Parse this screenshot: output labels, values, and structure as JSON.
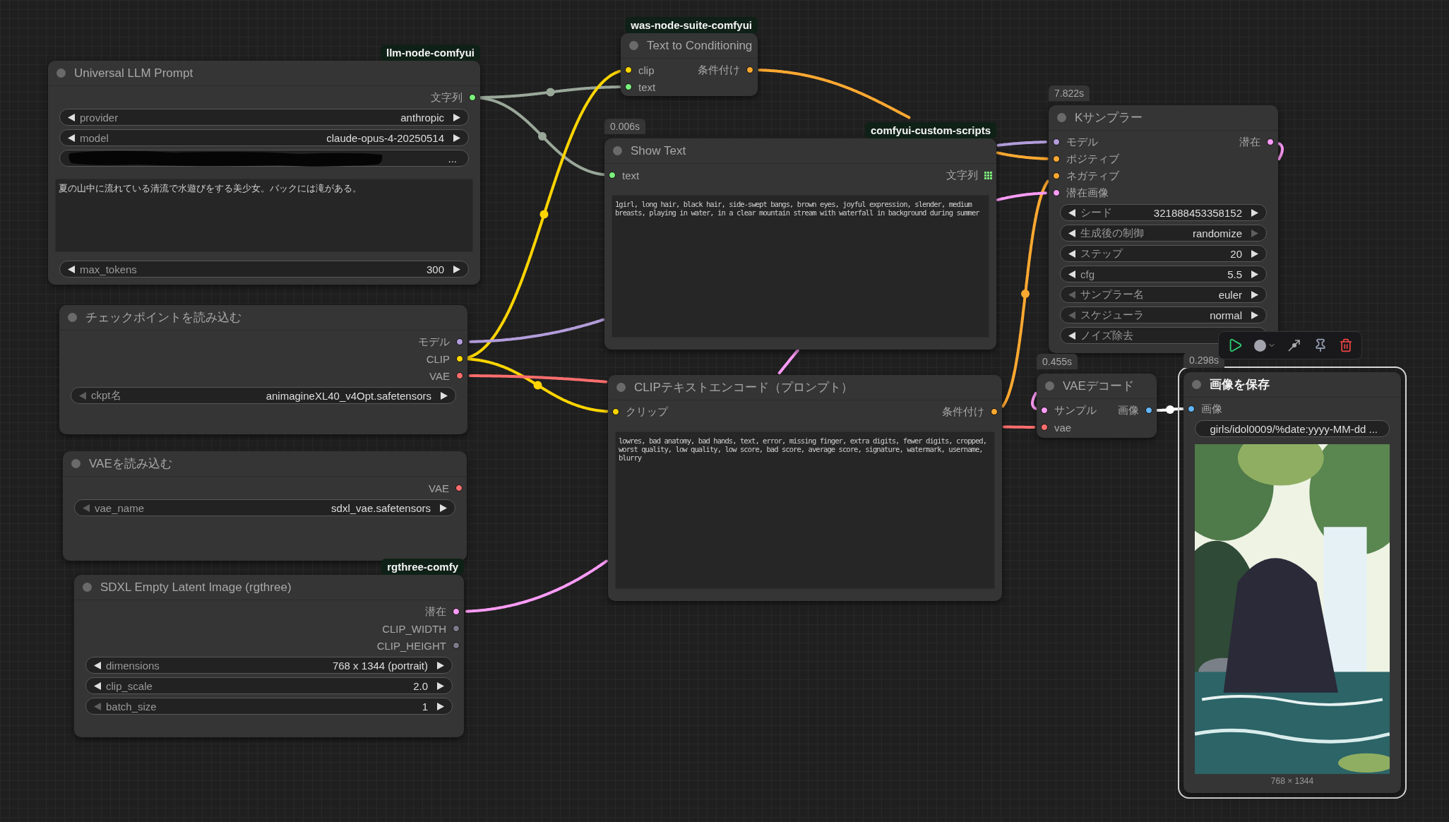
{
  "nodes": [
    {
      "title": "Universal LLM Prompt",
      "badge": "llm-node-comfyui",
      "selected": false,
      "slots": [
        {
          "output": {
            "label": "文字列",
            "color": "#7cf07c"
          }
        }
      ],
      "widgets": [
        {
          "kind": "stepper",
          "label": "provider",
          "value": "anthropic",
          "prev_enabled": true,
          "next_enabled": true
        },
        {
          "kind": "stepper",
          "label": "model",
          "value": "claude-opus-4-20250514",
          "prev_enabled": true,
          "next_enabled": true
        },
        {
          "kind": "text",
          "value": "...",
          "redacted": true
        },
        {
          "kind": "textarea",
          "value": "夏の山中に流れている清流で水遊びをする美少女。バックには滝がある。"
        },
        {
          "kind": "stepper",
          "label": "max_tokens",
          "value": "300",
          "prev_enabled": true,
          "next_enabled": true
        }
      ]
    },
    {
      "title": "Text to Conditioning",
      "badge": "was-node-suite-comfyui",
      "selected": false,
      "slots": [
        {
          "input": {
            "label": "clip",
            "color": "#ffd500"
          },
          "output": {
            "label": "条件付け",
            "color": "#ffa931"
          }
        },
        {
          "input": {
            "label": "text",
            "color": "#7cf07c"
          }
        }
      ]
    },
    {
      "title": "Show Text",
      "badge": "comfyui-custom-scripts",
      "timing": "0.006s",
      "selected": false,
      "slots": [
        {
          "input": {
            "label": "text",
            "color": "#7cf07c"
          },
          "output": {
            "label": "文字列",
            "color": "#7cf07c",
            "is_list": true
          }
        }
      ],
      "widgets": [
        {
          "kind": "code_textarea",
          "value": "1girl, long hair, black hair, side-swept bangs, brown eyes, joyful expression, slender, medium breasts, playing in water, in a clear mountain stream with waterfall in background during summer"
        }
      ]
    },
    {
      "title": "Kサンプラー",
      "timing": "7.822s",
      "selected": false,
      "slots": [
        {
          "input": {
            "label": "モデル",
            "color": "#b39ddb"
          },
          "output": {
            "label": "潜在",
            "color": "#ff9cf9"
          }
        },
        {
          "input": {
            "label": "ポジティブ",
            "color": "#ffa931"
          }
        },
        {
          "input": {
            "label": "ネガティブ",
            "color": "#ffa931"
          }
        },
        {
          "input": {
            "label": "潜在画像",
            "color": "#ff9cf9"
          }
        }
      ],
      "widgets": [
        {
          "kind": "stepper",
          "label": "シード",
          "value": "321888453358152",
          "prev_enabled": true,
          "next_enabled": true
        },
        {
          "kind": "stepper",
          "label": "生成後の制御",
          "value": "randomize",
          "prev_enabled": true,
          "next_enabled": false
        },
        {
          "kind": "stepper",
          "label": "ステップ",
          "value": "20",
          "prev_enabled": true,
          "next_enabled": true
        },
        {
          "kind": "stepper",
          "label": "cfg",
          "value": "5.5",
          "prev_enabled": true,
          "next_enabled": true
        },
        {
          "kind": "stepper",
          "label": "サンプラー名",
          "value": "euler",
          "prev_enabled": false,
          "next_enabled": true
        },
        {
          "kind": "stepper",
          "label": "スケジューラ",
          "value": "normal",
          "prev_enabled": false,
          "next_enabled": true
        },
        {
          "kind": "stepper",
          "label": "ノイズ除去",
          "prev_enabled": true
        }
      ]
    },
    {
      "title": "チェックポイントを読み込む",
      "selected": false,
      "slots": [
        {
          "output": {
            "label": "モデル",
            "color": "#b39ddb"
          }
        },
        {
          "output": {
            "label": "CLIP",
            "color": "#ffd500"
          }
        },
        {
          "output": {
            "label": "VAE",
            "color": "#ff6e6e"
          }
        }
      ],
      "widgets": [
        {
          "kind": "stepper",
          "label": "ckpt名",
          "value": "animagineXL40_v4Opt.safetensors",
          "prev_enabled": false,
          "next_enabled": true
        }
      ]
    },
    {
      "title": "VAEを読み込む",
      "selected": false,
      "slots": [
        {
          "output": {
            "label": "VAE",
            "color": "#ff6e6e"
          }
        }
      ],
      "widgets": [
        {
          "kind": "stepper",
          "label": "vae_name",
          "value": "sdxl_vae.safetensors",
          "prev_enabled": false,
          "next_enabled": true
        }
      ]
    },
    {
      "title": "SDXL Empty Latent Image (rgthree)",
      "badge": "rgthree-comfy",
      "selected": false,
      "slots": [
        {
          "output": {
            "label": "潜在",
            "color": "#ff9cf9"
          }
        },
        {
          "output": {
            "label": "CLIP_WIDTH",
            "color": "#7a7a8a"
          }
        },
        {
          "output": {
            "label": "CLIP_HEIGHT",
            "color": "#7a7a8a"
          }
        }
      ],
      "widgets": [
        {
          "kind": "stepper",
          "label": "dimensions",
          "value": "768 x 1344  (portrait)",
          "prev_enabled": true,
          "next_enabled": true
        },
        {
          "kind": "stepper",
          "label": "clip_scale",
          "value": "2.0",
          "prev_enabled": true,
          "next_enabled": true
        },
        {
          "kind": "stepper",
          "label": "batch_size",
          "value": "1",
          "prev_enabled": false,
          "next_enabled": true
        }
      ]
    },
    {
      "title": "CLIPテキストエンコード（プロンプト）",
      "selected": false,
      "slots": [
        {
          "input": {
            "label": "クリップ",
            "color": "#ffd500"
          },
          "output": {
            "label": "条件付け",
            "color": "#ffa931"
          }
        }
      ],
      "widgets": [
        {
          "kind": "code_textarea",
          "value": "lowres, bad anatomy, bad hands, text, error, missing finger, extra digits, fewer digits, cropped, worst quality, low quality, low score, bad score, average score, signature, watermark, username, blurry"
        }
      ]
    },
    {
      "title": "VAEデコード",
      "timing": "0.455s",
      "selected": false,
      "slots": [
        {
          "input": {
            "label": "サンプル",
            "color": "#ff9cf9"
          },
          "output": {
            "label": "画像",
            "color": "#64b5f6"
          }
        },
        {
          "input": {
            "label": "vae",
            "color": "#ff6e6e"
          }
        }
      ]
    },
    {
      "title": "画像を保存",
      "timing": "0.298s",
      "selected": true,
      "slots": [
        {
          "input": {
            "label": "画像",
            "color": "#64b5f6"
          }
        }
      ],
      "widgets": [
        {
          "kind": "text",
          "value": "girls/idol0009/%date:yyyy-MM-dd  ..."
        },
        {
          "kind": "preview",
          "caption": "768 × 1344"
        }
      ]
    }
  ],
  "links": [
    {
      "color": "#9aa89a"
    },
    {
      "color": "#9aa89a"
    },
    {
      "color": "#ffd500"
    },
    {
      "color": "#ffd500"
    },
    {
      "color": "#b39ddb"
    },
    {
      "color": "#ff6e6e"
    },
    {
      "color": "#ffa931"
    },
    {
      "color": "#ffa931"
    },
    {
      "color": "#ff9cf9"
    },
    {
      "color": "#ff9cf9"
    },
    {
      "color": "#ffffff"
    }
  ]
}
